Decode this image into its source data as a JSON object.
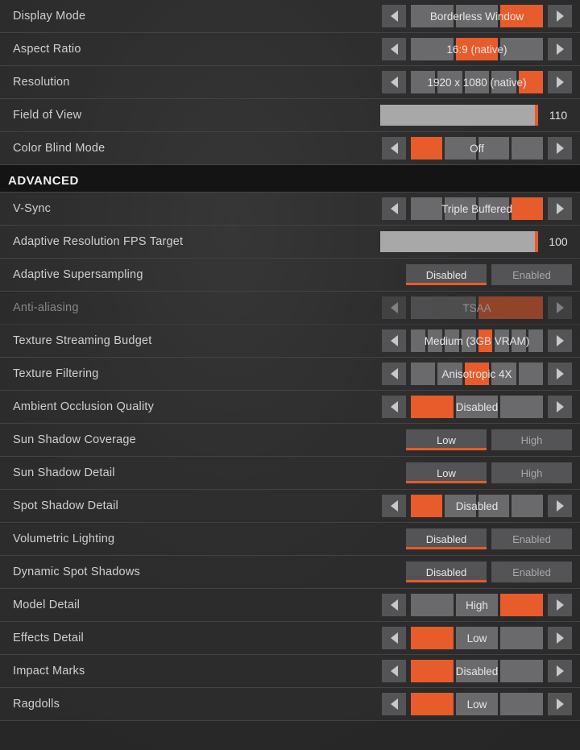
{
  "sections": {
    "advanced_header": "ADVANCED"
  },
  "settings": [
    {
      "id": "display-mode",
      "label": "Display Mode",
      "type": "select",
      "value": "Borderless Window",
      "segments": 3,
      "activeSegment": 2
    },
    {
      "id": "aspect-ratio",
      "label": "Aspect Ratio",
      "type": "select",
      "value": "16:9 (native)",
      "segments": 3,
      "activeSegment": 1
    },
    {
      "id": "resolution",
      "label": "Resolution",
      "type": "select",
      "value": "1920 x 1080 (native)",
      "segments": 5,
      "activeSegment": 4
    },
    {
      "id": "field-of-view",
      "label": "Field of View",
      "type": "slider",
      "value": "110"
    },
    {
      "id": "color-blind-mode",
      "label": "Color Blind Mode",
      "type": "select",
      "value": "Off",
      "segments": 4,
      "activeSegment": 0
    },
    {
      "id": "vsync",
      "label": "V-Sync",
      "type": "select",
      "value": "Triple Buffered",
      "segments": 4,
      "activeSegment": 3
    },
    {
      "id": "adaptive-res-fps",
      "label": "Adaptive Resolution FPS Target",
      "type": "slider",
      "value": "100"
    },
    {
      "id": "adaptive-supersampling",
      "label": "Adaptive Supersampling",
      "type": "toggle",
      "options": [
        "Disabled",
        "Enabled"
      ],
      "active": 0
    },
    {
      "id": "anti-aliasing",
      "label": "Anti-aliasing",
      "type": "select",
      "value": "TSAA",
      "segments": 2,
      "activeSegment": 1,
      "disabled": true
    },
    {
      "id": "texture-streaming",
      "label": "Texture Streaming Budget",
      "type": "select",
      "value": "Medium (3GB VRAM)",
      "segments": 8,
      "activeSegment": 4
    },
    {
      "id": "texture-filtering",
      "label": "Texture Filtering",
      "type": "select",
      "value": "Anisotropic 4X",
      "segments": 5,
      "activeSegment": 2
    },
    {
      "id": "ambient-occlusion",
      "label": "Ambient Occlusion Quality",
      "type": "select",
      "value": "Disabled",
      "segments": 3,
      "activeSegment": 0
    },
    {
      "id": "sun-shadow-coverage",
      "label": "Sun Shadow Coverage",
      "type": "toggle",
      "options": [
        "Low",
        "High"
      ],
      "active": 0
    },
    {
      "id": "sun-shadow-detail",
      "label": "Sun Shadow Detail",
      "type": "toggle",
      "options": [
        "Low",
        "High"
      ],
      "active": 0
    },
    {
      "id": "spot-shadow-detail",
      "label": "Spot Shadow Detail",
      "type": "select",
      "value": "Disabled",
      "segments": 4,
      "activeSegment": 0
    },
    {
      "id": "volumetric-lighting",
      "label": "Volumetric Lighting",
      "type": "toggle",
      "options": [
        "Disabled",
        "Enabled"
      ],
      "active": 0
    },
    {
      "id": "dynamic-spot-shadows",
      "label": "Dynamic Spot Shadows",
      "type": "toggle",
      "options": [
        "Disabled",
        "Enabled"
      ],
      "active": 0
    },
    {
      "id": "model-detail",
      "label": "Model Detail",
      "type": "select",
      "value": "High",
      "segments": 3,
      "activeSegment": 2
    },
    {
      "id": "effects-detail",
      "label": "Effects Detail",
      "type": "select",
      "value": "Low",
      "segments": 3,
      "activeSegment": 0
    },
    {
      "id": "impact-marks",
      "label": "Impact Marks",
      "type": "select",
      "value": "Disabled",
      "segments": 3,
      "activeSegment": 0
    },
    {
      "id": "ragdolls",
      "label": "Ragdolls",
      "type": "select",
      "value": "Low",
      "segments": 3,
      "activeSegment": 0
    }
  ]
}
